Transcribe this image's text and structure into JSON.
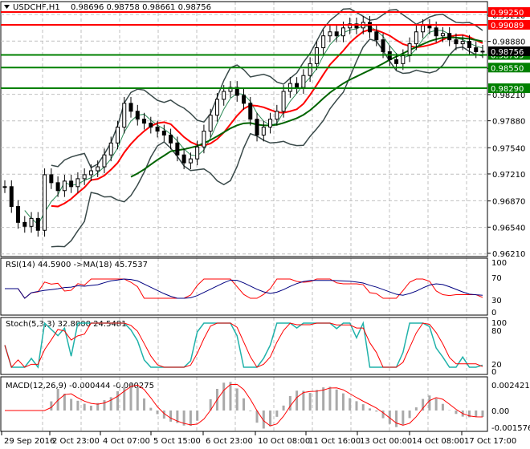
{
  "header": {
    "symbol": "USDCHF,H1",
    "ohlc": "0.98696 0.98758 0.98661 0.98756"
  },
  "chart_data": {
    "type": "candlestick",
    "symbol": "USDCHF",
    "timeframe": "H1",
    "price_ticks": [
      "0.99210",
      "0.98880",
      "0.98540",
      "0.98210",
      "0.97880",
      "0.97540",
      "0.97210",
      "0.96870",
      "0.96540",
      "0.96210"
    ],
    "price_range": [
      0.9618,
      0.994
    ],
    "time_labels": [
      "29 Sep 2016",
      "2 Oct 23:00",
      "4 Oct 07:00",
      "5 Oct 15:00",
      "6 Oct 23:00",
      "10 Oct 08:00",
      "11 Oct 16:00",
      "13 Oct 00:00",
      "14 Oct 08:00",
      "17 Oct 17:00"
    ],
    "closes": [
      0.9705,
      0.968,
      0.966,
      0.9655,
      0.9665,
      0.965,
      0.972,
      0.971,
      0.97,
      0.9712,
      0.9705,
      0.9715,
      0.972,
      0.9725,
      0.973,
      0.9745,
      0.976,
      0.978,
      0.981,
      0.98,
      0.979,
      0.9785,
      0.978,
      0.9775,
      0.977,
      0.976,
      0.9745,
      0.9735,
      0.974,
      0.9755,
      0.9775,
      0.9795,
      0.9815,
      0.9825,
      0.983,
      0.982,
      0.981,
      0.979,
      0.977,
      0.978,
      0.979,
      0.98,
      0.9825,
      0.9835,
      0.983,
      0.9845,
      0.986,
      0.988,
      0.9895,
      0.99,
      0.9895,
      0.9905,
      0.991,
      0.9905,
      0.9912,
      0.99,
      0.989,
      0.9875,
      0.9865,
      0.986,
      0.987,
      0.9885,
      0.99,
      0.9908,
      0.9905,
      0.9895,
      0.9898,
      0.989,
      0.9885,
      0.9888,
      0.988,
      0.9875,
      0.98756
    ],
    "levels": [
      {
        "label": "0.99250",
        "value": 0.9925,
        "color": "#ff0000"
      },
      {
        "label": "0.99089",
        "value": 0.99089,
        "color": "#ff0000"
      },
      {
        "label": "0.98709",
        "value": 0.98709,
        "color": "#008000"
      },
      {
        "label": "0.98550",
        "value": 0.9855,
        "color": "#008000"
      },
      {
        "label": "0.98290",
        "value": 0.9829,
        "color": "#008000"
      }
    ],
    "current_price": {
      "label": "0.98756",
      "value": 0.98756,
      "color": "#000000"
    },
    "grid": true,
    "indicators": {
      "rsi": {
        "title": "RSI(14) 44.5900  ->MA(18) 45.7537",
        "ticks": [
          "100",
          "70",
          "30",
          "0"
        ],
        "colors": [
          "#ff0000",
          "#000080"
        ]
      },
      "stoch": {
        "title": "Stoch(5,3,3) 32.8000 24.5481",
        "ticks": [
          "100",
          "80",
          "20",
          "0"
        ],
        "colors": [
          "#20b2aa",
          "#ff0000"
        ]
      },
      "macd": {
        "title": "MACD(12,26,9) -0.000444 -0.000275",
        "ticks": [
          "0.002421",
          "0.00",
          "-0.001576"
        ],
        "colors": [
          "#a9a9a9",
          "#ff0000"
        ]
      }
    }
  }
}
